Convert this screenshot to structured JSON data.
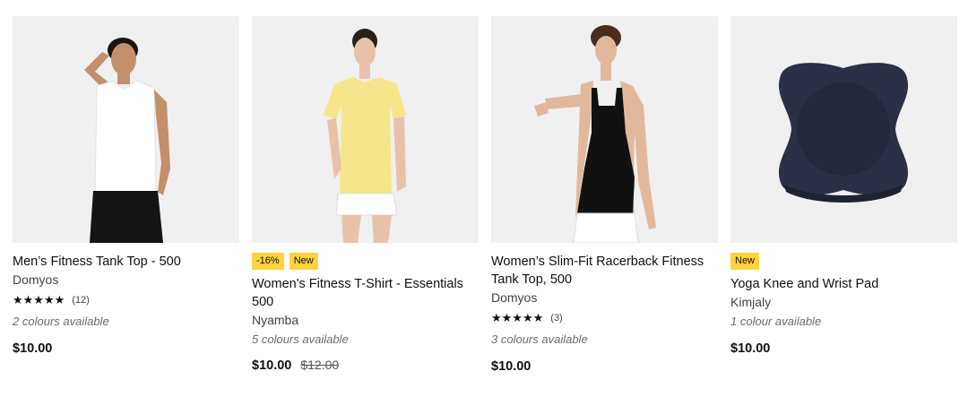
{
  "products": [
    {
      "title": "Men’s Fitness Tank Top - 500",
      "brand": "Domyos",
      "stars": "★★★★★",
      "reviews": "(12)",
      "availability": "2 colours available",
      "price": "$10.00"
    },
    {
      "badges": [
        "-16%",
        "New"
      ],
      "title_line1": "Women's Fitness T-Shirt - Essentials",
      "title_line2": "500",
      "brand": "Nyamba",
      "availability": "5 colours available",
      "price": "$10.00",
      "old_price": "$12.00"
    },
    {
      "title_line1": "Women’s Slim-Fit Racerback Fitness",
      "title_line2": "Tank Top, 500",
      "brand": "Domyos",
      "stars": "★★★★★",
      "reviews": "(3)",
      "availability": "3 colours available",
      "price": "$10.00"
    },
    {
      "badges": [
        "New"
      ],
      "title": "Yoga Knee and Wrist Pad",
      "brand": "Kimjaly",
      "availability": "1 colour available",
      "price": "$10.00"
    }
  ],
  "colors": {
    "badge": "#ffd33c",
    "image_bg": "#f0f0f0",
    "text": "#101010"
  }
}
